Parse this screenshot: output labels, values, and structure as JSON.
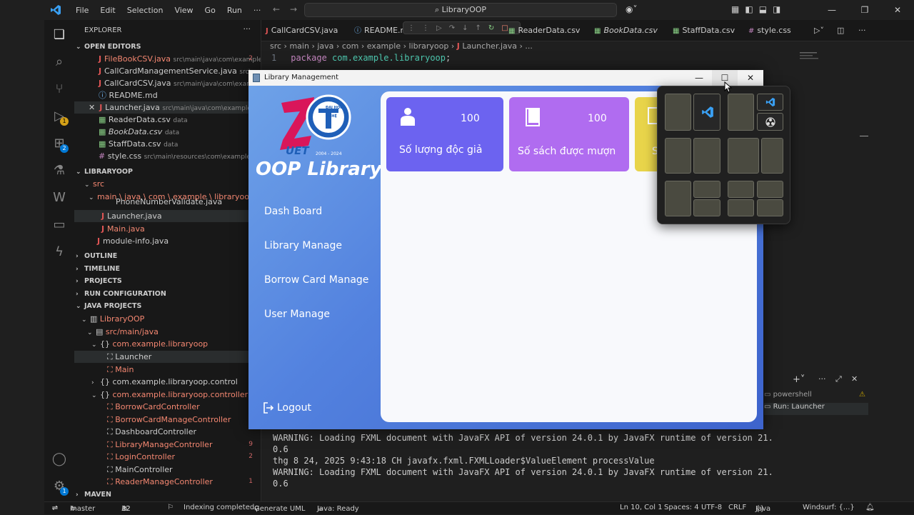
{
  "titlebar": {
    "menu": [
      "File",
      "Edit",
      "Selection",
      "View",
      "Go",
      "Run",
      "···"
    ],
    "search": "LibraryOOP"
  },
  "explorer": {
    "title": "EXPLORER",
    "open_editors_label": "OPEN EDITORS",
    "open_editors": [
      {
        "name": "FileBookCSV.java",
        "path": "src\\main\\java\\com\\example...",
        "badge": "2"
      },
      {
        "name": "CallCardManagementService.java",
        "path": "src\\main\\..."
      },
      {
        "name": "CallCardCSV.java",
        "path": "src\\main\\java\\com\\example..."
      },
      {
        "name": "README.md",
        "path": ""
      },
      {
        "name": "Launcher.java",
        "path": "src\\main\\java\\com\\example\\lib..."
      },
      {
        "name": "ReaderData.csv",
        "path": "data"
      },
      {
        "name": "BookData.csv",
        "path": "data"
      },
      {
        "name": "StaffData.csv",
        "path": "data"
      },
      {
        "name": "style.css",
        "path": "src\\main\\resources\\com\\example\\lib..."
      }
    ],
    "project_label": "LIBRARYOOP",
    "tree": [
      "src",
      "main \\ java \\ com \\ example \\ libraryoop",
      "PhoneNumberValidate.java",
      "Launcher.java",
      "Main.java",
      "module-info.java"
    ],
    "sections": [
      "OUTLINE",
      "TIMELINE",
      "PROJECTS",
      "RUN CONFIGURATION",
      "JAVA PROJECTS"
    ],
    "java_projects": [
      "LibraryOOP",
      "src/main/java",
      "com.example.libraryoop",
      "Launcher",
      "Main",
      "com.example.libraryoop.control",
      "com.example.libraryoop.controller",
      "BorrowCardController",
      "BorrowCardManageController",
      "DashboardController",
      "LibraryManageController",
      "LoginController",
      "MainController",
      "ReaderManageController"
    ],
    "java_badges": {
      "library_manage": "9",
      "login": "2",
      "reader_manage": "1"
    },
    "maven_label": "MAVEN"
  },
  "tabs": [
    "CallCardCSV.java",
    "README.m",
    "ReaderData.csv",
    "BookData.csv",
    "StaffData.csv",
    "style.css"
  ],
  "breadcrumb": [
    "src",
    "main",
    "java",
    "com",
    "example",
    "libraryoop",
    "Launcher.java",
    "..."
  ],
  "code": {
    "line_no": "1",
    "keyword": "package",
    "package": "com.example.libraryoop",
    "end": ";"
  },
  "terminal_tabs": [
    "powershell",
    "Run: Launcher"
  ],
  "terminal_lines": [
    "WARNING: Loading FXML document with JavaFX API of version 24.0.1 by JavaFX runtime of version 21.",
    "0.6",
    "thg 8 24, 2025 9:43:18 CH javafx.fxml.FXMLLoader$ValueElement processValue",
    "WARNING: Loading FXML document with JavaFX API of version 24.0.1 by JavaFX runtime of version 21.",
    "0.6"
  ],
  "statusbar": {
    "branch": "master",
    "errors": "32",
    "warnings": "32",
    "indexing": "Indexing completed.",
    "uml": "Generate UML",
    "java_status": "Java: Ready",
    "position": "Ln 10, Col 1",
    "spaces": "Spaces: 4",
    "encoding": "UTF-8",
    "eol": "CRLF",
    "language": "Java",
    "windsurf": "Windsurf: {...}"
  },
  "activity_badges": {
    "run": "1",
    "extensions": "2",
    "settings": "1"
  },
  "app": {
    "window_title": "Library Management",
    "brand": "OOP Library",
    "logo_text": "UET",
    "logo_years": "2004 - 2024",
    "logo_badge": "ĐẠI HỌC CÔNG NGHỆ",
    "nav": [
      "Dash Board",
      "Library Manage",
      "Borrow Card Manage",
      "User Manage"
    ],
    "logout": "Logout",
    "cards": [
      {
        "value": "100",
        "label": "Số lượng độc giả",
        "color": "#6c63f0"
      },
      {
        "value": "100",
        "label": "Số sách được mượn",
        "color": "#b06cf0"
      },
      {
        "value": "",
        "label": "S",
        "color": "#e8d44a"
      }
    ]
  },
  "colors": {
    "accent": "#0078d4",
    "app_gradient_start": "#6ea2e8",
    "app_gradient_end": "#3d63cc"
  }
}
